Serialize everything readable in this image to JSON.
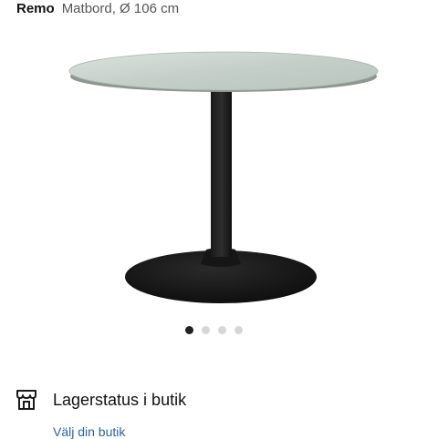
{
  "header": {
    "brand": "Remo",
    "subtitle": "Matbord, Ø 106 cm"
  },
  "carousel": {
    "total": 4,
    "active_index": 0
  },
  "stock": {
    "title": "Lagerstatus i butik",
    "link": "Välj din butik",
    "icon": "store-icon"
  },
  "colors": {
    "link": "#2a63a8",
    "table_base": "#111111",
    "table_top": "#c7d1cb",
    "dot_active": "#222222",
    "dot_inactive": "#d6d6d6"
  }
}
